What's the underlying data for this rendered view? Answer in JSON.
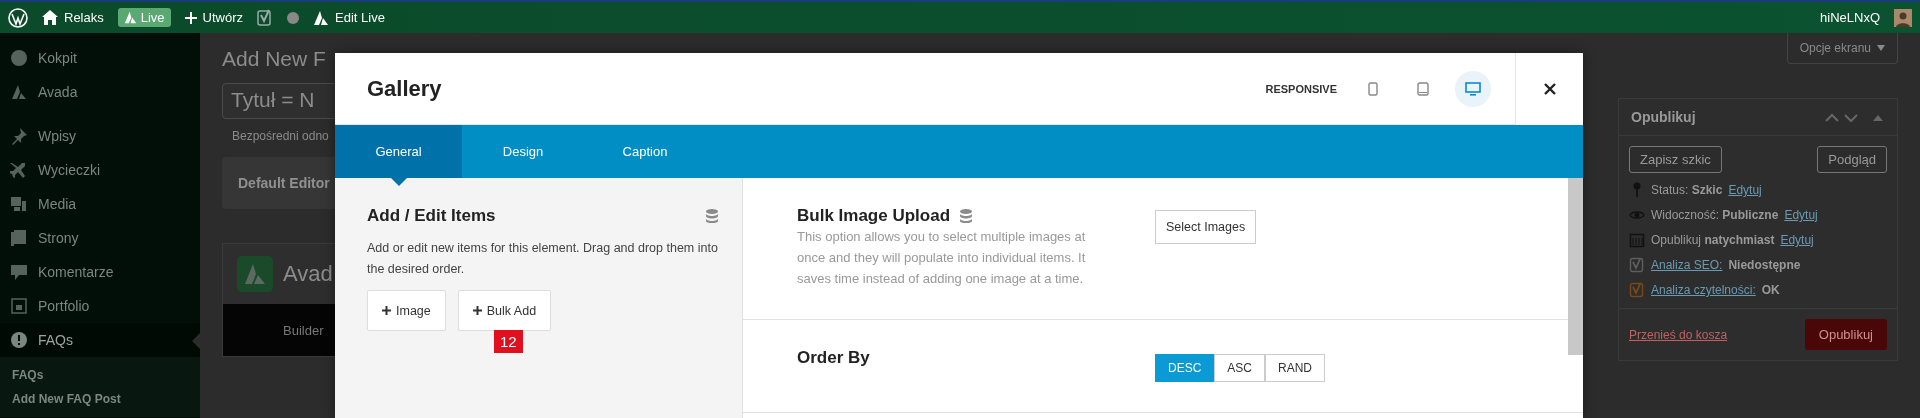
{
  "admin_bar": {
    "site": "Relaks",
    "live": "Live",
    "create": "Utwórz",
    "edit_live": "Edit Live",
    "user": "hiNeLNxQ"
  },
  "sidebar": {
    "items": [
      {
        "label": "Kokpit",
        "selected": false
      },
      {
        "label": "Avada",
        "selected": false
      },
      {
        "label": "Wpisy",
        "selected": false
      },
      {
        "label": "Wycieczki",
        "selected": false
      },
      {
        "label": "Media",
        "selected": false
      },
      {
        "label": "Strony",
        "selected": false
      },
      {
        "label": "Komentarze",
        "selected": false
      },
      {
        "label": "Portfolio",
        "selected": false
      },
      {
        "label": "FAQs",
        "selected": true
      }
    ],
    "submenu": [
      "FAQs",
      "Add New FAQ Post"
    ]
  },
  "page": {
    "heading": "Add New F",
    "title_value": "Tytuł = N",
    "permalink": "Bezpośredni odno",
    "editor_toggle": "Default Editor",
    "builder_title": "Avad",
    "builder_tab": "Builder"
  },
  "screen_options": "Opcje ekranu",
  "publish_box": {
    "title": "Opublikuj",
    "save_draft": "Zapisz szkic",
    "preview": "Podgląd",
    "rows": [
      {
        "kind": "status",
        "text": "Status: **Szkic**",
        "link": "Edytuj"
      },
      {
        "kind": "visibility",
        "text": "Widoczność: **Publiczne**",
        "link": "Edytuj"
      },
      {
        "kind": "schedule",
        "text": "Opublikuj **natychmiast**",
        "link": "Edytuj"
      },
      {
        "kind": "seo",
        "link": "Analiza SEO:",
        "text": "Niedostępne",
        "color": "#5e5e5e"
      },
      {
        "kind": "seo",
        "link": "Analiza czytelności:",
        "text": "OK",
        "color": "#7a4a16"
      }
    ],
    "trash": "Przenieś do kosza",
    "publish": "Opublikuj"
  },
  "modal": {
    "title": "Gallery",
    "responsive_label": "RESPONSIVE",
    "devices": [
      {
        "kind": "phone",
        "selected": false
      },
      {
        "kind": "tablet",
        "selected": false
      },
      {
        "kind": "desktop",
        "selected": true
      }
    ],
    "tabs": [
      {
        "label": "General",
        "selected": true
      },
      {
        "label": "Design",
        "selected": false
      },
      {
        "label": "Caption",
        "selected": false
      }
    ],
    "items_panel": {
      "title": "Add / Edit Items",
      "description": "Add or edit new items for this element. Drag and drop them into the desired order.",
      "buttons": [
        "Image",
        "Bulk Add"
      ],
      "badge": "12"
    },
    "options": [
      {
        "kind": "button",
        "title": "Bulk Image Upload",
        "description": "This option allows you to select multiple images at once and they will populate into individual items. It saves time instead of adding one image at a time.",
        "button": "Select Images"
      },
      {
        "kind": "choice",
        "title": "Order By",
        "choices": [
          {
            "label": "DESC",
            "selected": true
          },
          {
            "label": "ASC",
            "selected": false
          },
          {
            "label": "RAND",
            "selected": false
          }
        ]
      }
    ]
  }
}
